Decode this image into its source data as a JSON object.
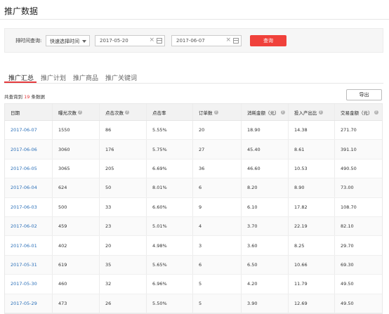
{
  "page": {
    "title": "推广数据"
  },
  "filter": {
    "label": "排时间查询:",
    "quick_select": "快速选择时间",
    "start_date": "2017-05-20",
    "end_date": "2017-06-07",
    "clear_glyph": "×",
    "query_button": "查询",
    "query_button_color": "#f0413b"
  },
  "tabs": [
    {
      "label": "推广汇总",
      "active": true
    },
    {
      "label": "推广计划",
      "active": false
    },
    {
      "label": "推广商品",
      "active": false
    },
    {
      "label": "推广关键词",
      "active": false
    }
  ],
  "summary": {
    "prefix": "共查询到",
    "count": "19",
    "suffix": "条数据"
  },
  "export_button": "导出",
  "table": {
    "headers": [
      {
        "label": "日期",
        "help": false
      },
      {
        "label": "曝光次数",
        "help": true
      },
      {
        "label": "点击次数",
        "help": true
      },
      {
        "label": "点击率",
        "help": false
      },
      {
        "label": "订单数",
        "help": true
      },
      {
        "label": "消耗金额（元）",
        "help": true
      },
      {
        "label": "投入产出比",
        "help": true
      },
      {
        "label": "交易金额（元）",
        "help": true
      }
    ],
    "help_glyph": "?",
    "rows": [
      [
        "2017-06-07",
        "1550",
        "86",
        "5.55%",
        "20",
        "18.90",
        "14.38",
        "271.70"
      ],
      [
        "2017-06-06",
        "3060",
        "176",
        "5.75%",
        "27",
        "45.40",
        "8.61",
        "391.10"
      ],
      [
        "2017-06-05",
        "3065",
        "205",
        "6.69%",
        "36",
        "46.60",
        "10.53",
        "490.50"
      ],
      [
        "2017-06-04",
        "624",
        "50",
        "8.01%",
        "6",
        "8.20",
        "8.90",
        "73.00"
      ],
      [
        "2017-06-03",
        "500",
        "33",
        "6.60%",
        "9",
        "6.10",
        "17.82",
        "108.70"
      ],
      [
        "2017-06-02",
        "459",
        "23",
        "5.01%",
        "4",
        "3.70",
        "22.19",
        "82.10"
      ],
      [
        "2017-06-01",
        "402",
        "20",
        "4.98%",
        "3",
        "3.60",
        "8.25",
        "29.70"
      ],
      [
        "2017-05-31",
        "619",
        "35",
        "5.65%",
        "6",
        "6.50",
        "10.66",
        "69.30"
      ],
      [
        "2017-05-30",
        "460",
        "32",
        "6.96%",
        "5",
        "4.20",
        "11.79",
        "49.50"
      ],
      [
        "2017-05-29",
        "473",
        "26",
        "5.50%",
        "5",
        "3.90",
        "12.69",
        "49.50"
      ]
    ]
  }
}
